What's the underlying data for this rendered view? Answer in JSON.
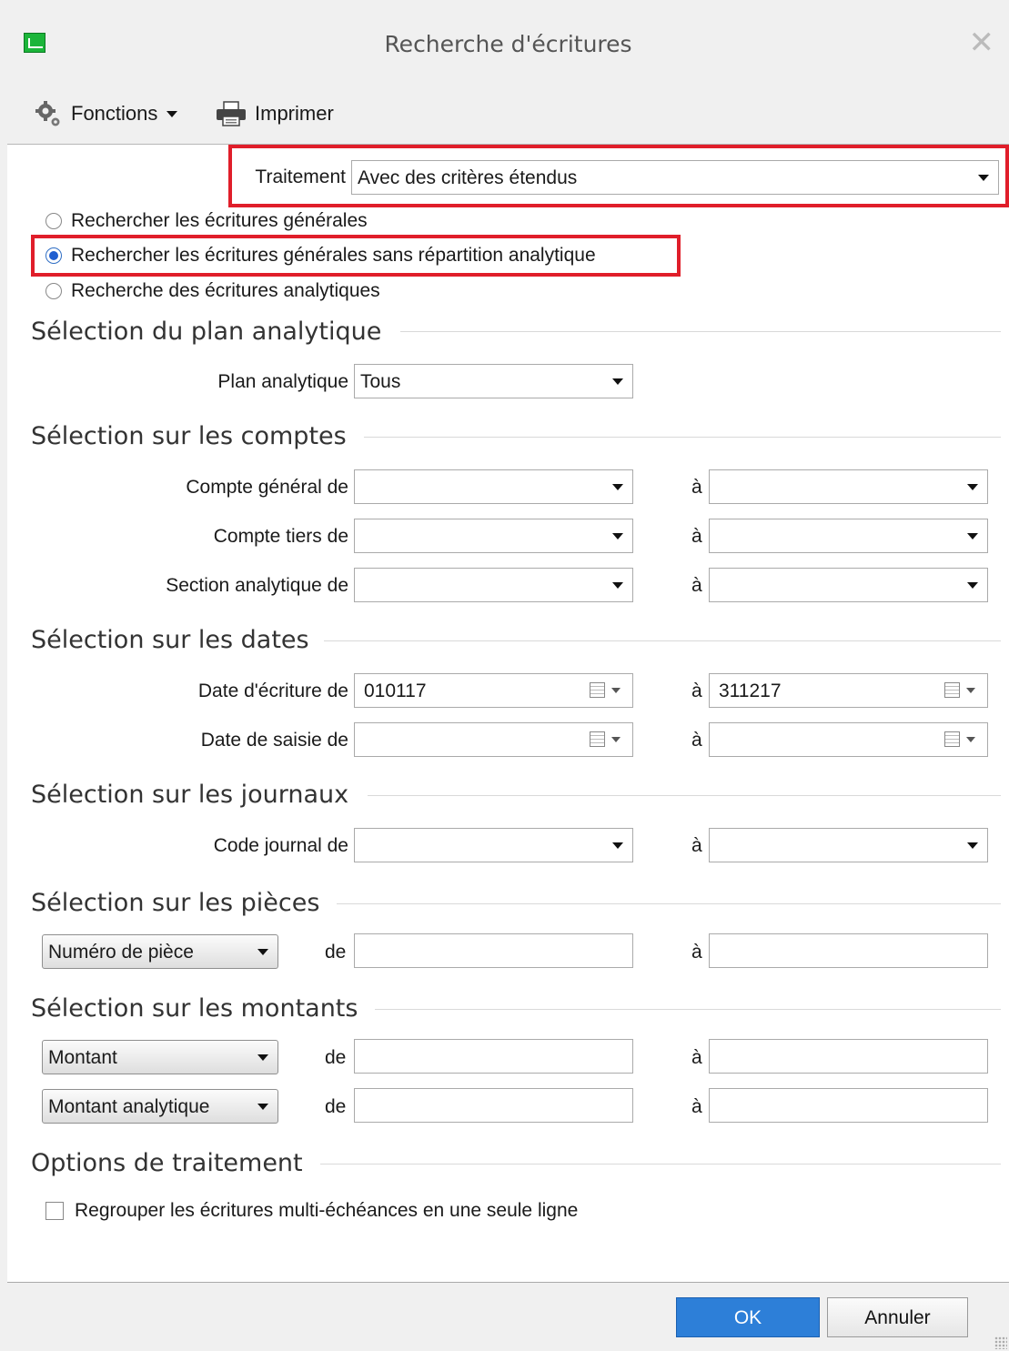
{
  "window": {
    "title": "Recherche d'écritures"
  },
  "toolbar": {
    "functions_label": "Fonctions",
    "print_label": "Imprimer"
  },
  "traitement": {
    "label": "Traitement",
    "value": "Avec des critères étendus"
  },
  "search_modes": [
    {
      "label": "Rechercher les écritures générales",
      "selected": false
    },
    {
      "label": "Rechercher les écritures générales sans répartition analytique",
      "selected": true
    },
    {
      "label": "Recherche des écritures analytiques",
      "selected": false
    }
  ],
  "sections": {
    "plan": "Sélection du plan analytique",
    "comptes": "Sélection sur les comptes",
    "dates": "Sélection sur les dates",
    "journaux": "Sélection sur les journaux",
    "pieces": "Sélection sur les pièces",
    "montants": "Sélection sur les montants",
    "options": "Options de traitement"
  },
  "plan": {
    "label": "Plan analytique",
    "value": "Tous"
  },
  "comptes": {
    "general_label": "Compte général de",
    "tiers_label": "Compte tiers de",
    "section_label": "Section analytique de"
  },
  "dates": {
    "ecriture_label": "Date d'écriture de",
    "ecriture_from": "010117",
    "ecriture_to": "311217",
    "saisie_label": "Date de saisie de"
  },
  "journaux": {
    "code_label": "Code journal de"
  },
  "pieces": {
    "type_value": "Numéro de pièce"
  },
  "montants": {
    "type1_value": "Montant",
    "type2_value": "Montant analytique"
  },
  "range": {
    "de": "de",
    "a": "à"
  },
  "options": {
    "group_label": "Regrouper les écritures multi-échéances en une seule ligne",
    "group_checked": false
  },
  "buttons": {
    "ok": "OK",
    "cancel": "Annuler"
  },
  "colors": {
    "highlight": "#e01e2a",
    "primary_button": "#2d7fd8",
    "radio_selected": "#1f5ed0"
  }
}
